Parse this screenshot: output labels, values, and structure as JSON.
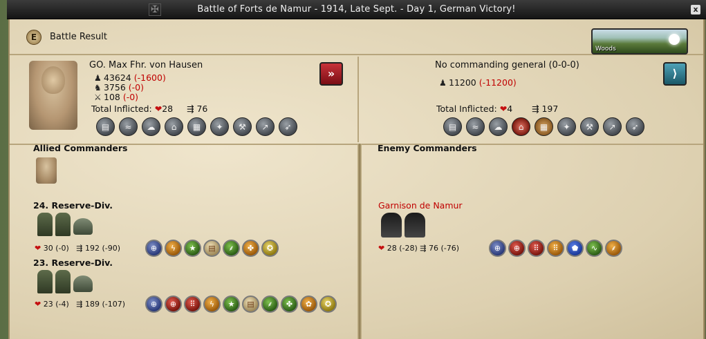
{
  "window": {
    "title": "Battle of Forts de Namur - 1914, Late Sept. - Day 1, German Victory!",
    "close_label": "x"
  },
  "header": {
    "badge": "E",
    "title": "Battle Result",
    "terrain": "Woods"
  },
  "attacker": {
    "general": "GO. Max Fhr. von Hausen",
    "infantry": "43624",
    "infantry_loss": "(-1600)",
    "cavalry": "3756",
    "cavalry_loss": "(-0)",
    "artillery": "108",
    "artillery_loss": "(-0)",
    "inflicted_label": "Total Inflicted:",
    "hits": "28",
    "disruption": "76",
    "action_icon": "retreat-icon",
    "section_title": "Allied Commanders"
  },
  "defender": {
    "general": "No commanding general (0-0-0)",
    "infantry": "11200",
    "infantry_loss": "(-11200)",
    "inflicted_label": "Total Inflicted:",
    "hits": "4",
    "disruption": "197",
    "action_icon": "defend-icon",
    "section_title": "Enemy Commanders"
  },
  "divisions": {
    "allied": [
      {
        "name": "24. Reserve-Div.",
        "hits": "30",
        "hits_loss": "(-0)",
        "dis": "192",
        "dis_loss": "(-90)"
      },
      {
        "name": "23. Reserve-Div.",
        "hits": "23",
        "hits_loss": "(-4)",
        "dis": "189",
        "dis_loss": "(-107)"
      }
    ],
    "enemy": [
      {
        "name": "Garnison de Namur",
        "hits": "28",
        "hits_loss": "(-28)",
        "dis": "76",
        "dis_loss": "(-76)"
      }
    ]
  },
  "colors": {
    "loss": "#c00000",
    "panel": "#e8dcc0",
    "titlebar": "#1f1f1f"
  }
}
